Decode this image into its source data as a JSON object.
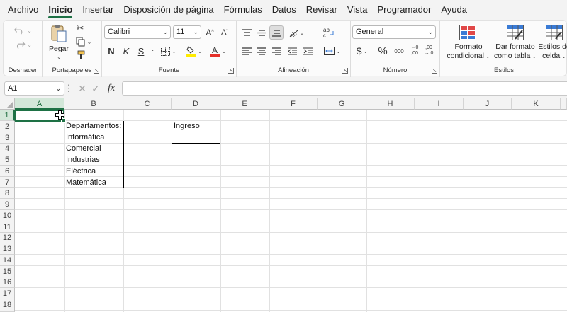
{
  "menu": {
    "tabs": [
      "Archivo",
      "Inicio",
      "Insertar",
      "Disposición de página",
      "Fórmulas",
      "Datos",
      "Revisar",
      "Vista",
      "Programador",
      "Ayuda"
    ],
    "active": "Inicio"
  },
  "ribbon": {
    "groups": {
      "undo": "Deshacer",
      "clipboard": "Portapapeles",
      "font": "Fuente",
      "alignment": "Alineación",
      "number": "Número",
      "styles": "Estilos"
    },
    "paste_label": "Pegar",
    "font_name": "Calibri",
    "font_size": "11",
    "bold": "N",
    "italic": "K",
    "underline": "S",
    "number_format": "General",
    "currency_symbol": "$",
    "percent_symbol": "%",
    "thousands_label": "000",
    "conditional_format": [
      "Formato",
      "condicional"
    ],
    "format_table": [
      "Dar formato",
      "como tabla"
    ],
    "cell_styles": [
      "Estilos de",
      "celda"
    ]
  },
  "formula_bar": {
    "name_box": "A1",
    "fx": "fx",
    "formula": ""
  },
  "sheet": {
    "columns": [
      "A",
      "B",
      "C",
      "D",
      "E",
      "F",
      "G",
      "H",
      "I",
      "J",
      "K"
    ],
    "rows": [
      "1",
      "2",
      "3",
      "4",
      "5",
      "6",
      "7",
      "8",
      "9",
      "10",
      "11",
      "12",
      "13",
      "14",
      "15",
      "16",
      "17",
      "18"
    ],
    "selected_cell": "A1",
    "cells": {
      "B2": "Departamentos:",
      "D2": "Ingreso",
      "B3": "Informática",
      "B4": "Comercial",
      "B5": "Industrias",
      "B6": "Eléctrica",
      "B7": "Matemática"
    }
  },
  "colors": {
    "accent": "#1e7145",
    "header_selected": "#d3e7d9",
    "ribbon_bg": "#f3f3f3"
  }
}
